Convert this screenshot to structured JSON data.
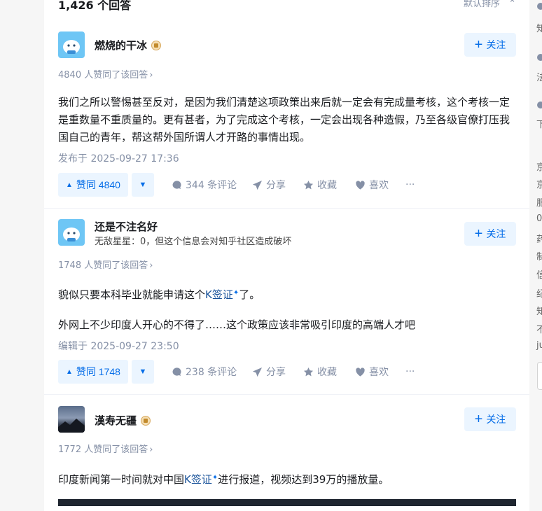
{
  "header": {
    "answer_count": "1,426 个回答",
    "sort_label": "默认排序",
    "sort_icon": "chevron-updown-icon"
  },
  "answers": [
    {
      "author": "燃烧的干冰",
      "has_badge": true,
      "bio": "",
      "follow_label": "关注",
      "votes_meta": "4840 人赞同了该回答",
      "paragraphs": [
        "我们之所以警惕甚至反对，是因为我们清楚这项政策出来后就一定会有完成量考核，这个考核一定是重数量不重质量的。更有甚者，为了完成这个考核，一定会出现各种造假，乃至各级官僚打压我国自己的青年，帮这帮外国所谓人才开路的事情出现。"
      ],
      "time": "发布于 2025-09-27 17:36",
      "vote_label": "赞同 4840",
      "comments": "344 条评论",
      "share": "分享",
      "collect": "收藏",
      "like": "喜欢",
      "more": "···"
    },
    {
      "author": "还是不注名好",
      "has_badge": false,
      "bio": "无敌星星：0，但这个信息会对知乎社区造成破坏",
      "follow_label": "关注",
      "votes_meta": "1748 人赞同了该回答",
      "p1_before": "貌似只要本科毕业就能申请这个",
      "p1_link": "K签证",
      "p1_after": "了。",
      "p2": "外网上不少印度人开心的不得了……这个政策应该非常吸引印度的高端人才吧",
      "time": "编辑于 2025-09-27 23:50",
      "vote_label": "赞同 1748",
      "comments": "238 条评论",
      "share": "分享",
      "collect": "收藏",
      "like": "喜欢",
      "more": "···"
    },
    {
      "author": "漢寿无疆",
      "has_badge": true,
      "bio": "",
      "follow_label": "关注",
      "votes_meta": "1772 人赞同了该回答",
      "p1_before": "印度新闻第一时间就对中国",
      "p1_link": "K签证",
      "p1_after": "进行报道，视频达到39万的播放量。"
    }
  ],
  "right_column": {
    "items": [
      "知",
      "法",
      "下",
      "京",
      "京",
      "服",
      "0",
      "药",
      "制",
      "信",
      "纪",
      "知",
      "不",
      "ju"
    ]
  },
  "colors": {
    "accent": "#056de8",
    "accent_bg": "#ebf5ff",
    "muted": "#8590a6",
    "link": "#175199"
  }
}
